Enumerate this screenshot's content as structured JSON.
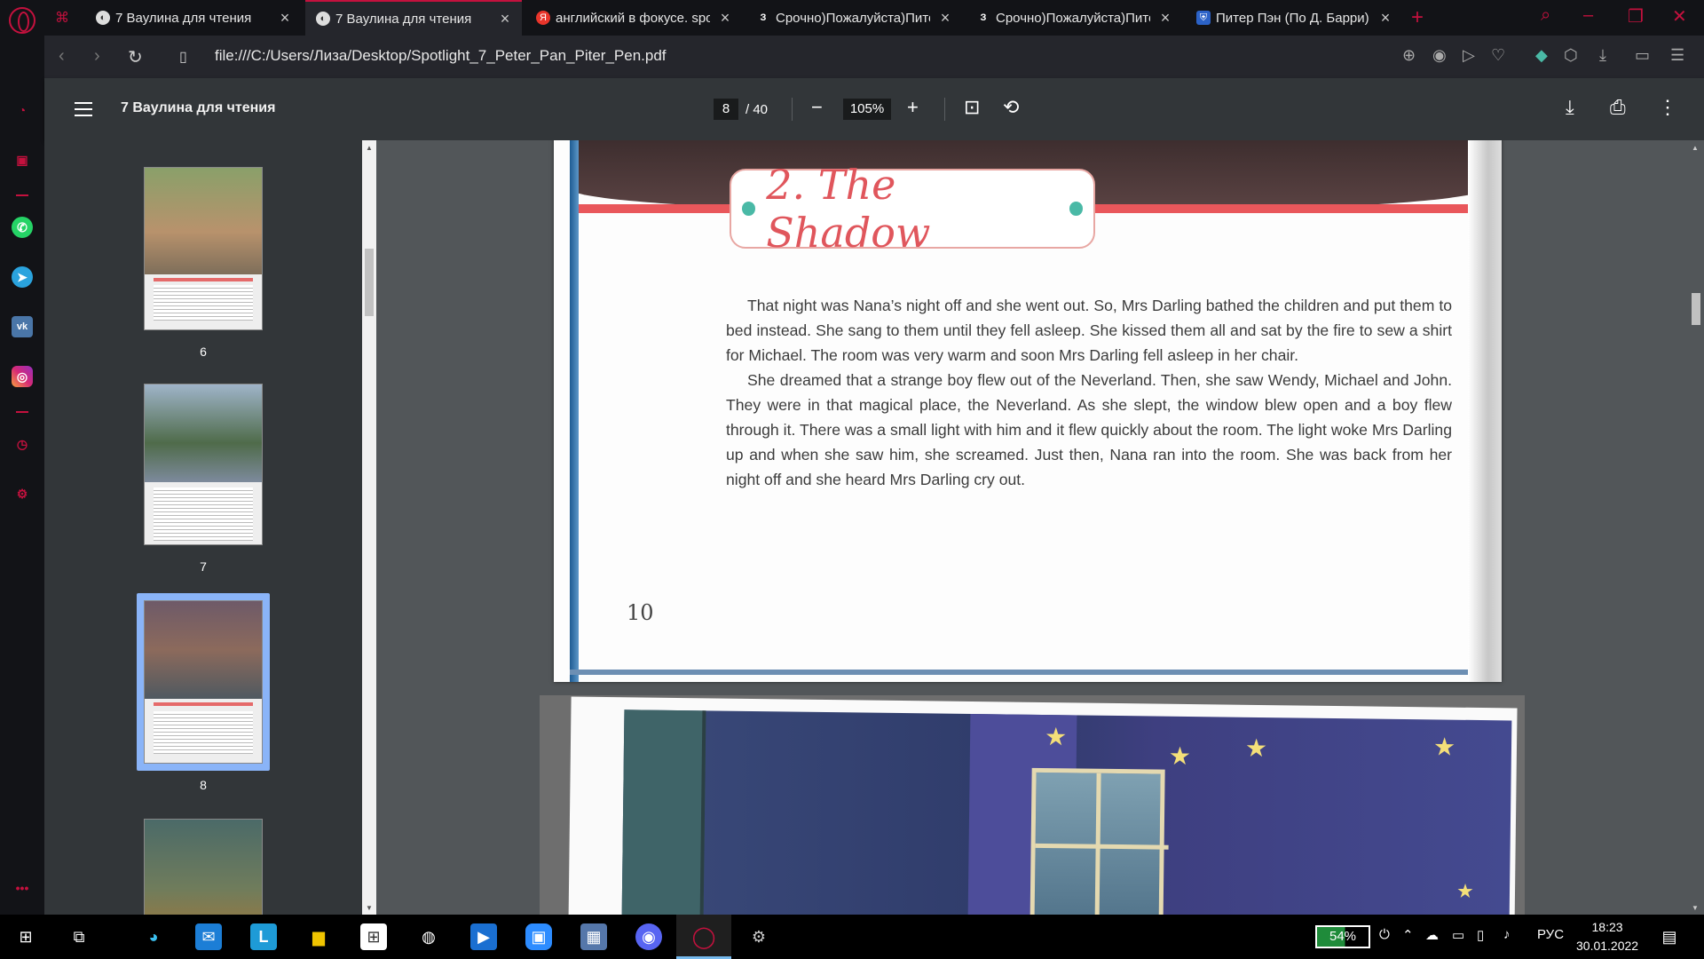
{
  "browser": {
    "tabs": [
      {
        "title": "7 Ваулина для чтения",
        "active": false
      },
      {
        "title": "7 Ваулина для чтения",
        "active": true
      },
      {
        "title": "английский в фокусе. spot",
        "active": false
      },
      {
        "title": "Срочно)Пожалуйста)Пите",
        "active": false
      },
      {
        "title": "Срочно)Пожалуйста)Пите",
        "active": false
      },
      {
        "title": "Питер Пэн (По Д. Барри).",
        "active": false
      }
    ],
    "url": "file:///C:/Users/Лиза/Desktop/Spotlight_7_Peter_Pan_Piter_Pen.pdf",
    "accent_color": "#c4113e"
  },
  "viewer": {
    "doc_title": "7 Ваулина для чтения",
    "current_page": "8",
    "total_pages": "/ 40",
    "zoom": "105%",
    "thumbnails": [
      {
        "label": "6"
      },
      {
        "label": "7"
      },
      {
        "label": "8",
        "selected": true
      },
      {
        "label": ""
      }
    ]
  },
  "page": {
    "chapter_title": "2. The Shadow",
    "paragraphs": [
      "That night was Nana’s night off and she went out. So, Mrs Darling bathed the children and put them to bed instead. She sang to them until they fell asleep. She kissed them all and sat by the fire to sew a shirt for Michael. The room was very warm and soon Mrs Darling fell asleep in her chair.",
      "She dreamed that a strange boy flew out of the Neverland. Then, she saw Wendy, Michael and John.  They were in that magical place, the Neverland. As she slept, the window blew open and a boy flew through it. There was a small light with him and it flew quickly about the room. The light woke Mrs Darling up and when she saw him, she screamed. Just then, Nana ran into the room. She was back from her night off and she heard Mrs Darling cry out."
    ],
    "page_number": "10"
  },
  "taskbar": {
    "battery": "54%",
    "language": "РУС",
    "time": "18:23",
    "date": "30.01.2022"
  }
}
